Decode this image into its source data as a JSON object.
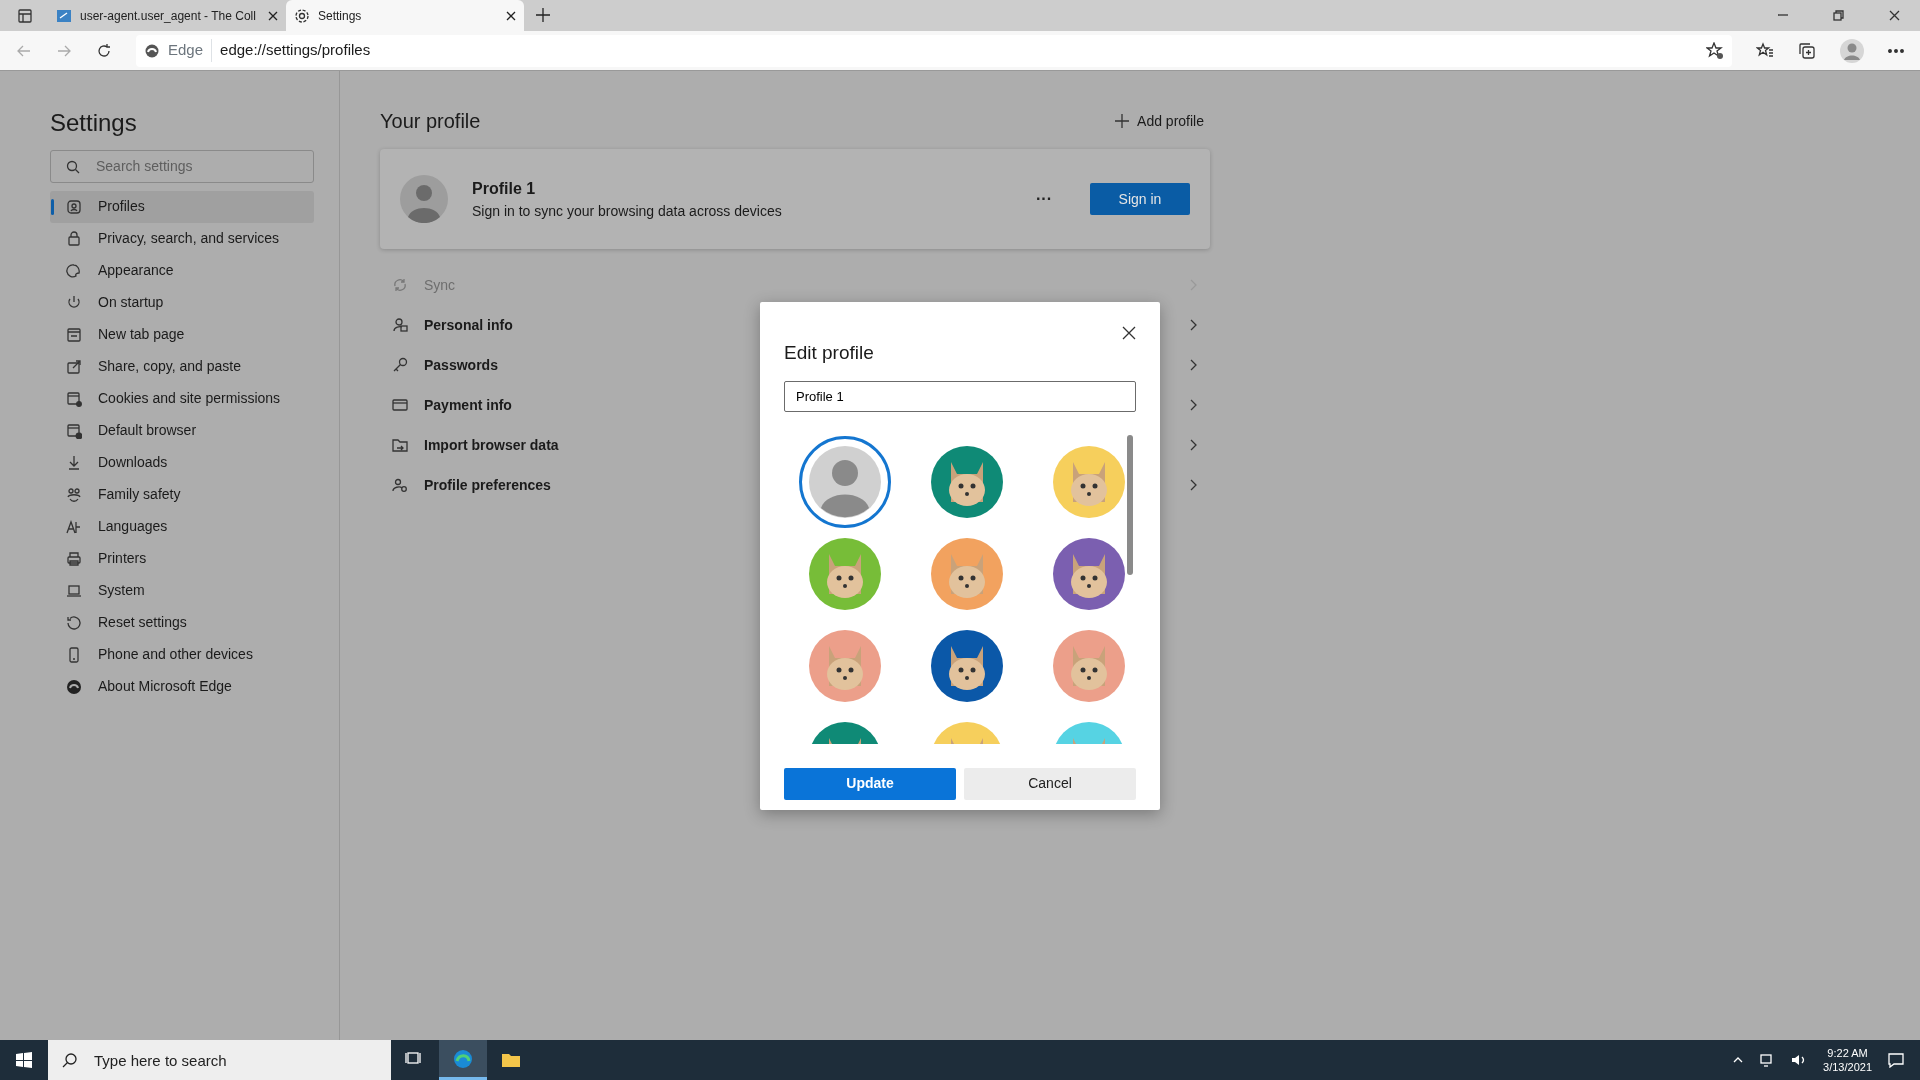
{
  "browser": {
    "tabs": [
      {
        "title": "user-agent.user_agent - The Coll",
        "selected": false
      },
      {
        "title": "Settings",
        "selected": true
      }
    ],
    "address": {
      "site_label": "Edge",
      "url": "edge://settings/profiles"
    }
  },
  "sidebar": {
    "title": "Settings",
    "search": {
      "placeholder": "Search settings"
    },
    "items": [
      {
        "label": "Profiles",
        "selected": true
      },
      {
        "label": "Privacy, search, and services",
        "selected": false
      },
      {
        "label": "Appearance",
        "selected": false
      },
      {
        "label": "On startup",
        "selected": false
      },
      {
        "label": "New tab page",
        "selected": false
      },
      {
        "label": "Share, copy, and paste",
        "selected": false
      },
      {
        "label": "Cookies and site permissions",
        "selected": false
      },
      {
        "label": "Default browser",
        "selected": false
      },
      {
        "label": "Downloads",
        "selected": false
      },
      {
        "label": "Family safety",
        "selected": false
      },
      {
        "label": "Languages",
        "selected": false
      },
      {
        "label": "Printers",
        "selected": false
      },
      {
        "label": "System",
        "selected": false
      },
      {
        "label": "Reset settings",
        "selected": false
      },
      {
        "label": "Phone and other devices",
        "selected": false
      },
      {
        "label": "About Microsoft Edge",
        "selected": false
      }
    ]
  },
  "main": {
    "title": "Your profile",
    "add_profile": "Add profile",
    "profile_card": {
      "name": "Profile 1",
      "description": "Sign in to sync your browsing data across devices",
      "more": "···",
      "sign_in": "Sign in"
    },
    "rows": [
      {
        "label": "Sync",
        "disabled": true
      },
      {
        "label": "Personal info",
        "disabled": false
      },
      {
        "label": "Passwords",
        "disabled": false
      },
      {
        "label": "Payment info",
        "disabled": false
      },
      {
        "label": "Import browser data",
        "disabled": false
      },
      {
        "label": "Profile preferences",
        "disabled": false
      }
    ]
  },
  "dialog": {
    "title": "Edit profile",
    "name_field": {
      "value": "Profile 1"
    },
    "avatars": [
      {
        "color": "#d0d0d0",
        "selected": true
      },
      {
        "color": "#0f8a76",
        "selected": false
      },
      {
        "color": "#f6cf5c",
        "selected": false
      },
      {
        "color": "#77bd38",
        "selected": false
      },
      {
        "color": "#f2a25f",
        "selected": false
      },
      {
        "color": "#7b5fb0",
        "selected": false
      },
      {
        "color": "#ec9f8a",
        "selected": false
      },
      {
        "color": "#0b58a8",
        "selected": false
      },
      {
        "color": "#ec9f8a",
        "selected": false
      },
      {
        "color": "#0f8a76",
        "selected": false
      },
      {
        "color": "#f6cf5c",
        "selected": false
      },
      {
        "color": "#56d3e3",
        "selected": false
      }
    ],
    "buttons": [
      {
        "label": "Update",
        "kind": "primary"
      },
      {
        "label": "Cancel",
        "kind": "secondary"
      }
    ]
  },
  "taskbar": {
    "search": {
      "placeholder": "Type here to search"
    },
    "apps": [
      {
        "selected": false
      },
      {
        "selected": true
      },
      {
        "selected": false
      }
    ],
    "time": "9:22 AM",
    "date": "3/13/2021"
  }
}
